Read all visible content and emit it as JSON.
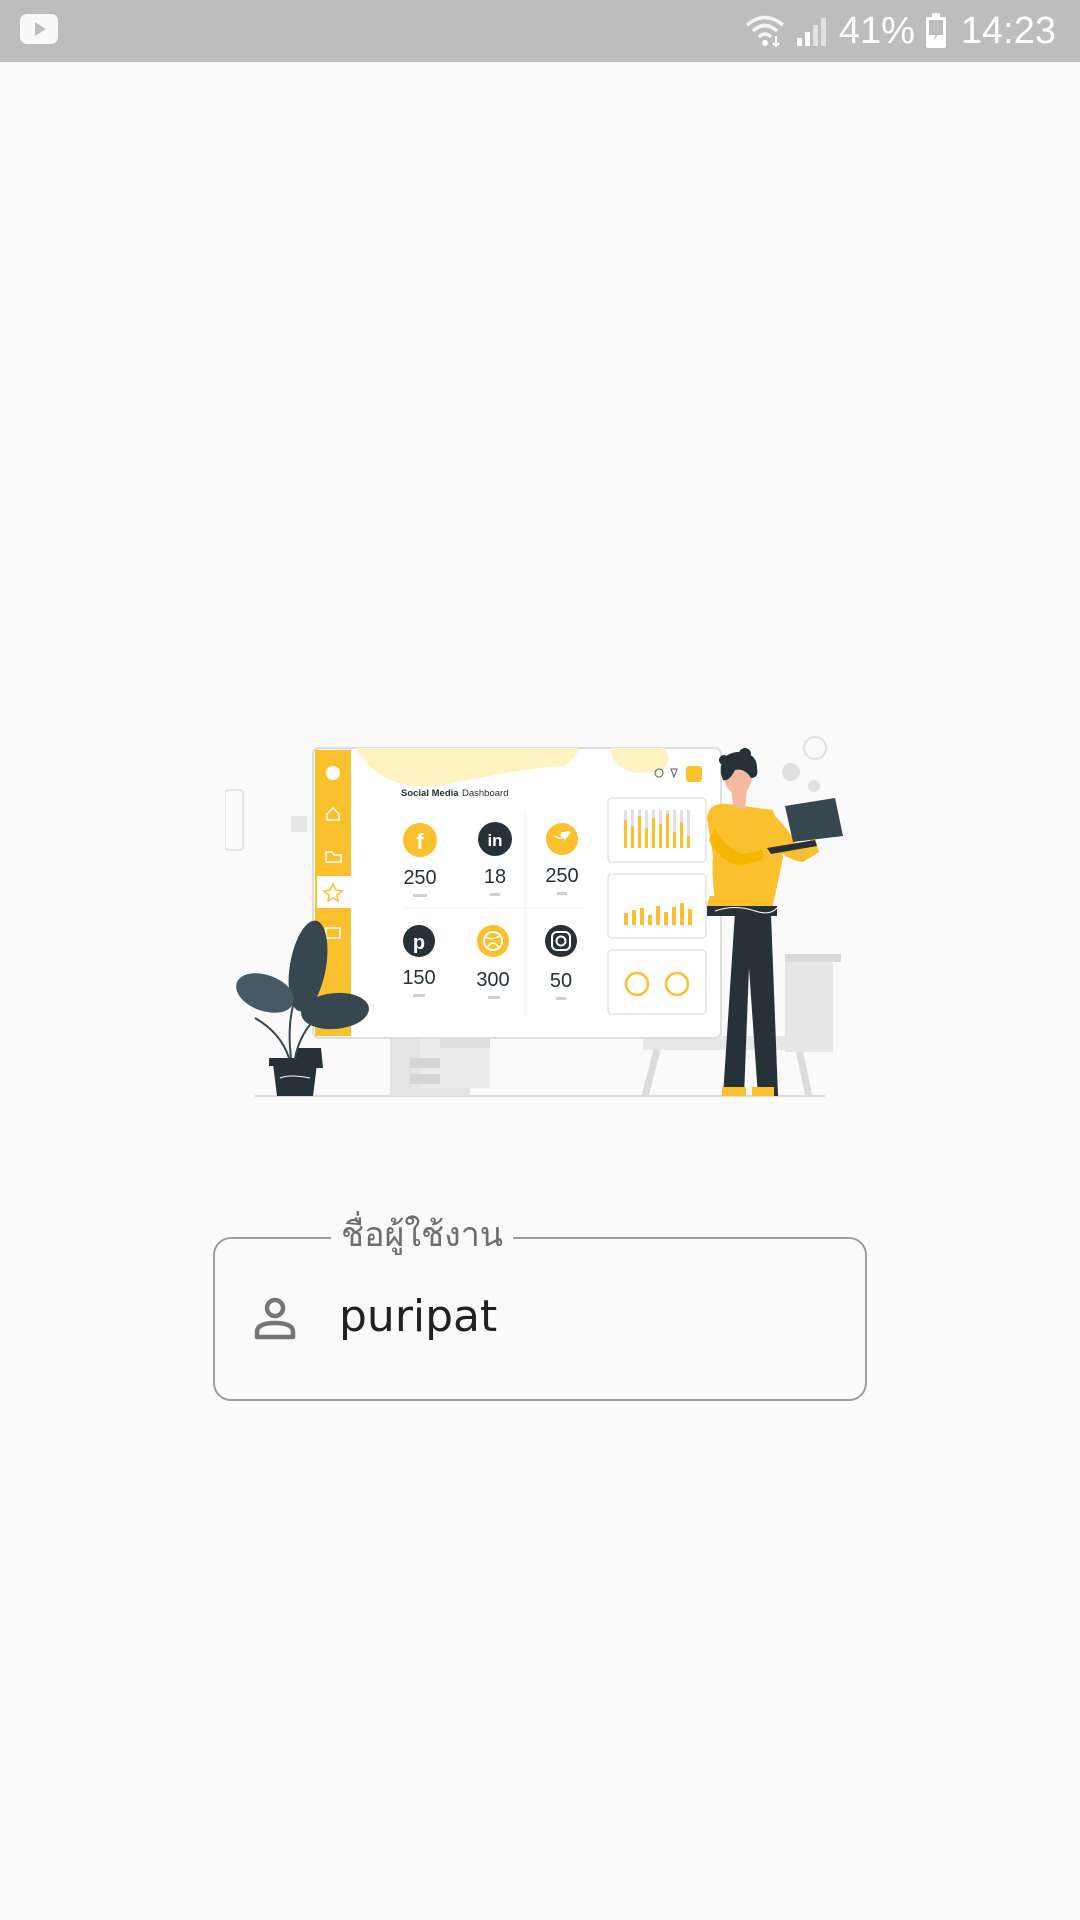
{
  "status_bar": {
    "battery_percent": "41%",
    "time": "14:23",
    "notification_icon": "youtube-icon"
  },
  "illustration": {
    "title_bold": "Social Media",
    "title_light": "Dashboard",
    "stats": [
      {
        "network": "facebook",
        "value": "250"
      },
      {
        "network": "linkedin",
        "value": "18"
      },
      {
        "network": "twitter",
        "value": "250"
      },
      {
        "network": "pinterest",
        "value": "150"
      },
      {
        "network": "dribbble",
        "value": "300"
      },
      {
        "network": "instagram",
        "value": "50"
      }
    ],
    "colors": {
      "accent": "#fbc02d",
      "dark": "#263238"
    }
  },
  "username_field": {
    "label": "ชื่อผู้ใช้งาน",
    "value": "puripat",
    "icon": "person-icon"
  }
}
